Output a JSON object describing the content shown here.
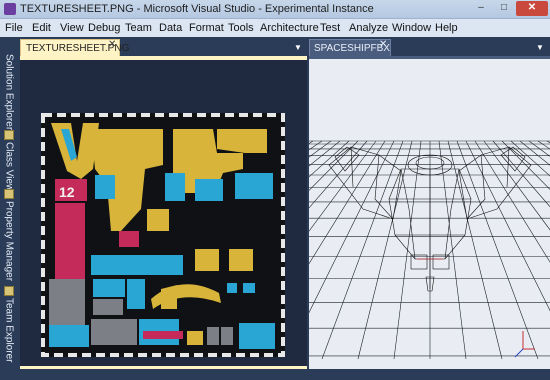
{
  "window": {
    "title": "TEXTURESHEET.PNG - Microsoft Visual Studio - Experimental Instance",
    "minimize_glyph": "–",
    "maximize_glyph": "□",
    "close_glyph": "✕"
  },
  "menu": [
    "File",
    "Edit",
    "View",
    "Debug",
    "Team",
    "Data",
    "Format",
    "Tools",
    "Architecture",
    "Test",
    "Analyze",
    "Window",
    "Help"
  ],
  "side_tabs": [
    "Solution Explorer",
    "Class View",
    "Property Manager",
    "Team Explorer"
  ],
  "documents": {
    "texture_tab": "TEXTURESHEET.PNG",
    "model_tab": "SPACESHIPFBX",
    "close_glyph": "✕",
    "dropdown_glyph": "▼"
  },
  "texture": {
    "badge_number": "12"
  },
  "colors": {
    "yellow": "#d8b53a",
    "cyan": "#2aa6d4",
    "magenta": "#c42a5a",
    "gray": "#7d7f86",
    "dark": "#101114"
  }
}
